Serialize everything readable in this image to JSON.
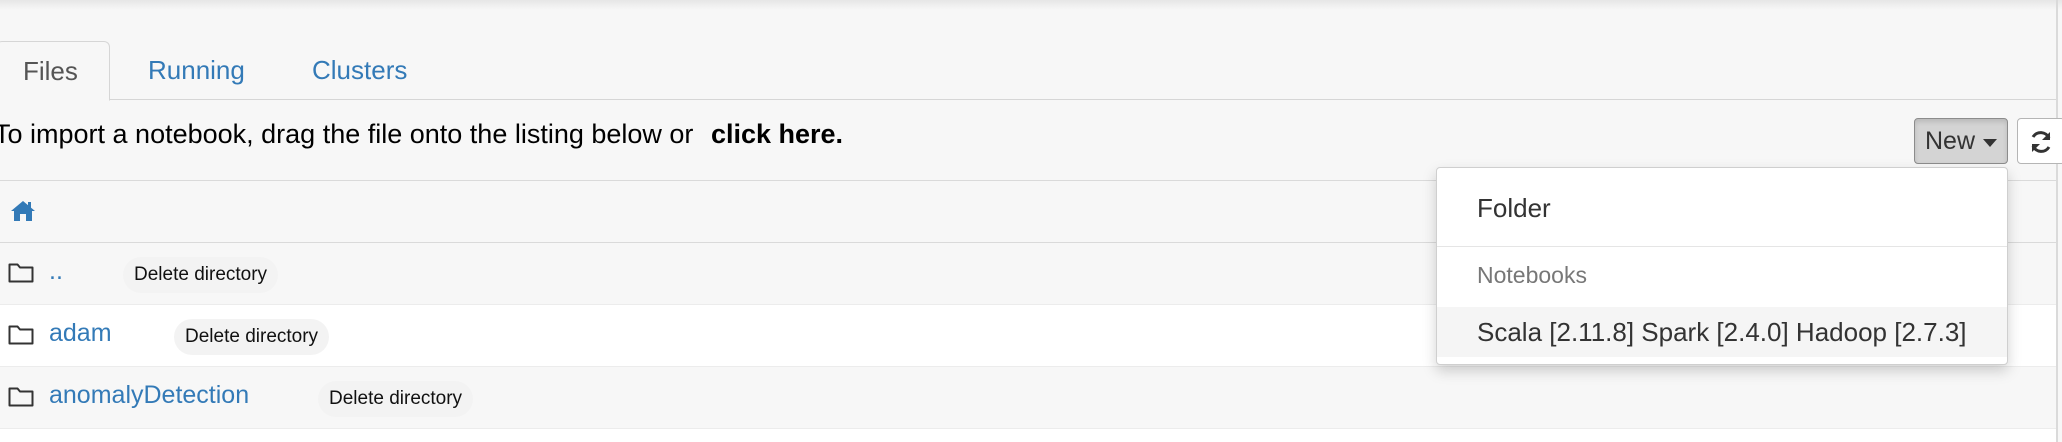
{
  "tabs": {
    "files": "Files",
    "running": "Running",
    "clusters": "Clusters"
  },
  "import_bar": {
    "text": "To import a notebook, drag the file onto the listing below or",
    "link": "click here."
  },
  "toolbar": {
    "new_label": "New",
    "refresh_icon": "refresh-icon"
  },
  "breadcrumb": {
    "home_icon": "home-icon"
  },
  "rows": [
    {
      "name": "..",
      "action": "Delete directory",
      "icon": "folder-icon"
    },
    {
      "name": "adam",
      "action": "Delete directory",
      "icon": "folder-icon"
    },
    {
      "name": "anomalyDetection",
      "action": "Delete directory",
      "icon": "folder-icon"
    }
  ],
  "new_menu": {
    "folder": "Folder",
    "notebooks_header": "Notebooks",
    "kernel": "Scala [2.11.8] Spark [2.4.0] Hadoop [2.7.3]"
  },
  "colors": {
    "link": "#337ab7",
    "background": "#f7f7f7",
    "active_button": "#d4d4d4"
  }
}
